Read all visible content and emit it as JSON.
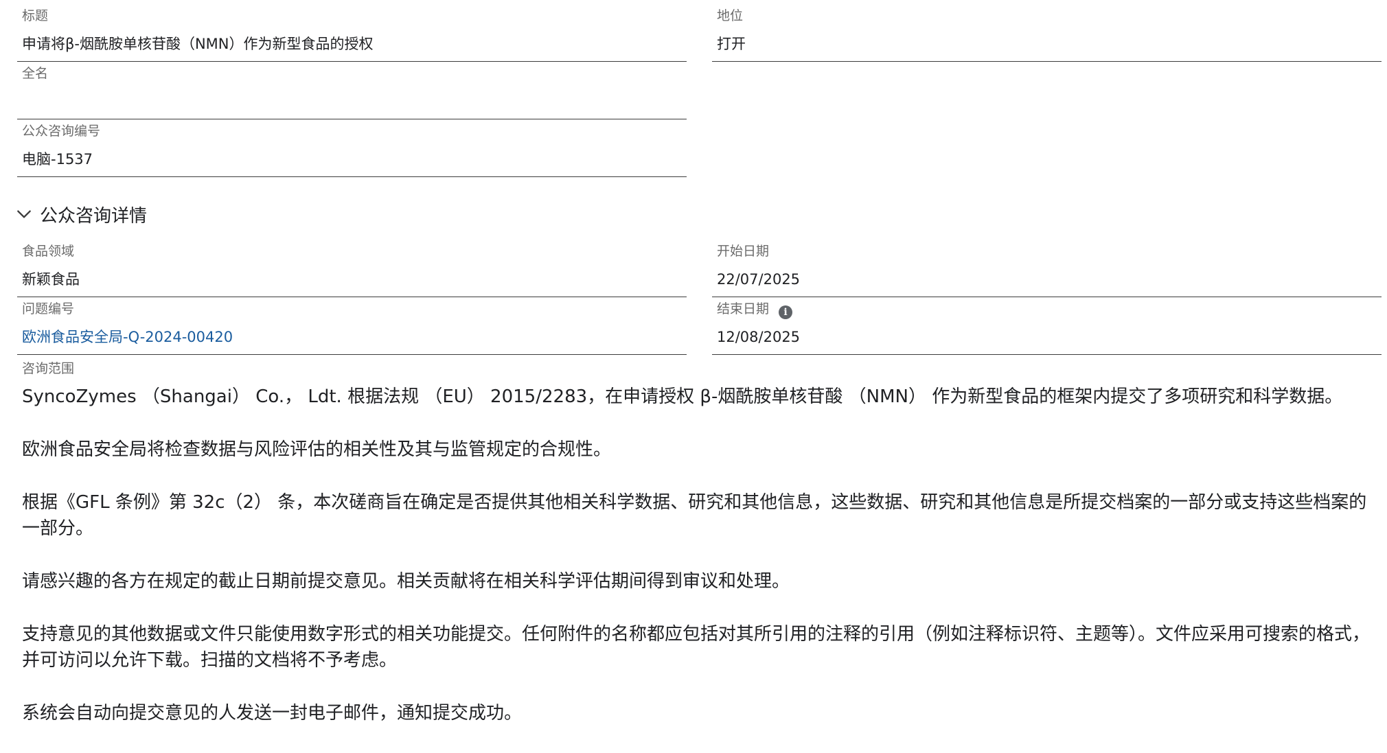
{
  "fields": {
    "title": {
      "label": "标题",
      "value": "申请将β-烟酰胺单核苷酸（NMN）作为新型食品的授权"
    },
    "status": {
      "label": "地位",
      "value": "打开"
    },
    "full_name": {
      "label": "全名",
      "value": ""
    },
    "consultation_number": {
      "label": "公众咨询编号",
      "value": "电脑-1537"
    }
  },
  "section": {
    "title": "公众咨询详情",
    "expanded": true,
    "icon": "chevron-down-icon"
  },
  "details": {
    "food_sector": {
      "label": "食品领域",
      "value": "新颖食品"
    },
    "start_date": {
      "label": "开始日期",
      "value": "22/07/2025"
    },
    "question_number": {
      "label": "问题编号",
      "value": "欧洲食品安全局-Q-2024-00420"
    },
    "end_date": {
      "label": "结束日期",
      "value": "12/08/2025",
      "icon": "info-icon"
    }
  },
  "scope": {
    "label": "咨询范围",
    "paragraphs": [
      "SyncoZymes （Shangai） Co.， Ldt. 根据法规 （EU） 2015/2283，在申请授权 β-烟酰胺单核苷酸 （NMN） 作为新型食品的框架内提交了多项研究和科学数据。",
      "欧洲食品安全局将检查数据与风险评估的相关性及其与监管规定的合规性。",
      "根据《GFL 条例》第 32c（2） 条，本次磋商旨在确定是否提供其他相关科学数据、研究和其他信息，这些数据、研究和其他信息是所提交档案的一部分或支持这些档案的一部分。",
      "请感兴趣的各方在规定的截止日期前提交意见。相关贡献将在相关科学评估期间得到审议和处理。",
      "支持意见的其他数据或文件只能使用数字形式的相关功能提交。任何附件的名称都应包括对其所引用的注释的引用（例如注释标识符、主题等）。文件应采用可搜索的格式，并可访问以允许下载。扫描的文档将不予考虑。",
      "系统会自动向提交意见的人发送一封电子邮件，通知提交成功。"
    ]
  },
  "colors": {
    "label": "#6b6b6b",
    "text": "#202124",
    "link": "#1a5c9e",
    "underline": "#3c3c3c"
  }
}
